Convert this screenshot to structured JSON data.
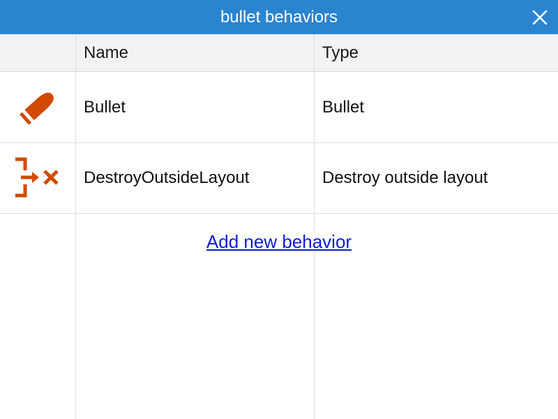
{
  "window": {
    "title": "bullet behaviors",
    "accent_color": "#2b84d0",
    "close_icon": "close-icon"
  },
  "table": {
    "columns": [
      "Name",
      "Type"
    ],
    "rows": [
      {
        "icon": "bullet-icon",
        "name": "Bullet",
        "type": "Bullet"
      },
      {
        "icon": "destroy-outside-layout-icon",
        "name": "DestroyOutsideLayout",
        "type": "Destroy outside layout"
      }
    ],
    "icon_color": "#d24a00"
  },
  "actions": {
    "add_new_label": "Add new behavior",
    "link_color": "#0b1cd6"
  }
}
